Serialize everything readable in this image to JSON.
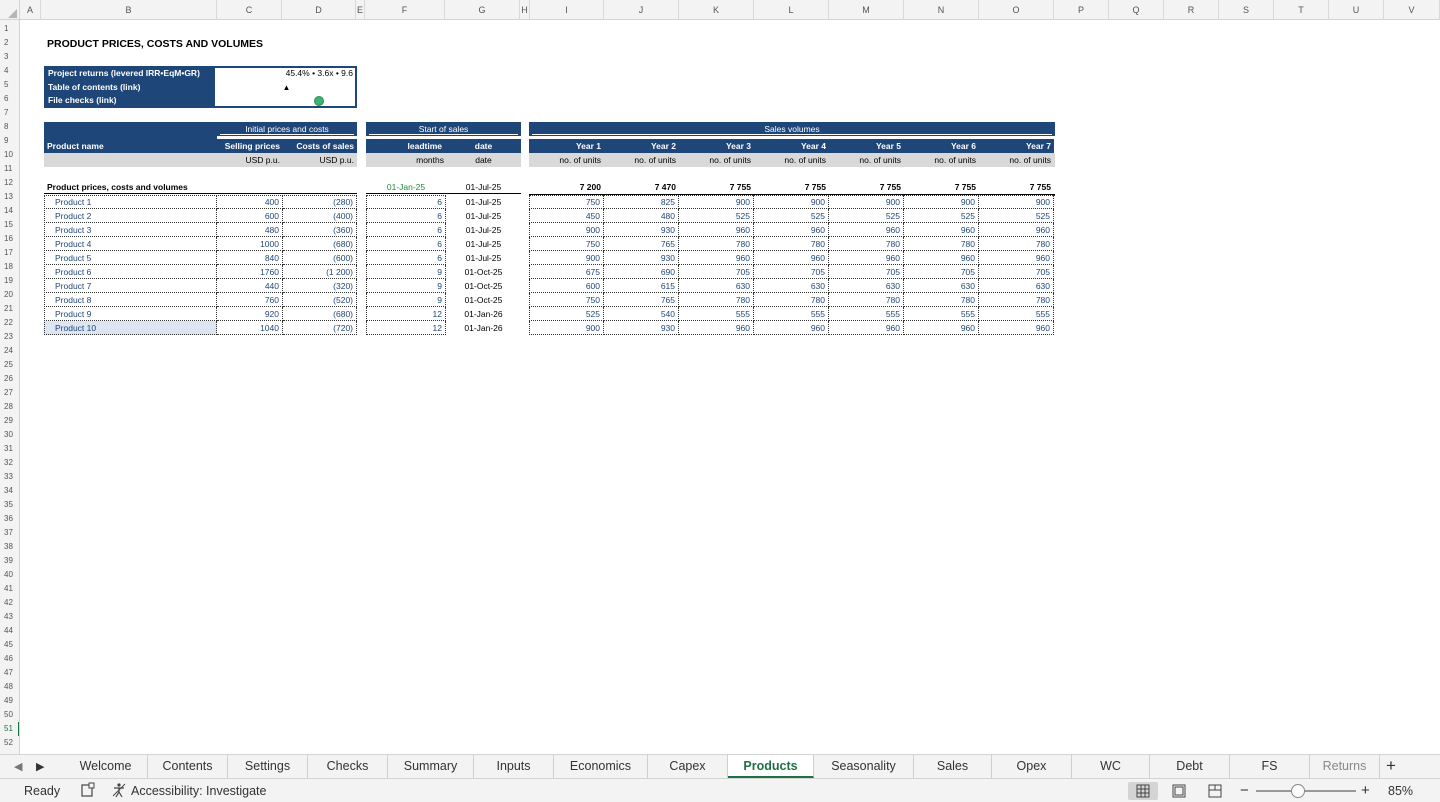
{
  "columns": [
    "A",
    "B",
    "C",
    "D",
    "E",
    "F",
    "G",
    "H",
    "I",
    "J",
    "K",
    "L",
    "M",
    "N",
    "O",
    "P",
    "Q",
    "R",
    "S",
    "T",
    "U",
    "V"
  ],
  "rows": [
    "1",
    "2",
    "3",
    "4",
    "5",
    "6",
    "7",
    "8",
    "9",
    "10",
    "11",
    "12",
    "13",
    "14",
    "15",
    "16",
    "17",
    "18",
    "19",
    "20",
    "21",
    "22",
    "23",
    "24",
    "25",
    "26",
    "27",
    "28",
    "29",
    "30",
    "31",
    "32",
    "33",
    "34",
    "35",
    "36",
    "37",
    "38",
    "39",
    "40",
    "41",
    "42",
    "43",
    "44",
    "45",
    "46",
    "47",
    "48",
    "49",
    "50",
    "51",
    "52"
  ],
  "active_row": "51",
  "sheet": {
    "title": "PRODUCT PRICES, COSTS AND VOLUMES",
    "summary_box": {
      "project_returns_label": "Project returns (levered IRR•EqM•GR)",
      "project_returns_value": "45.4% • 3.6x • 9.6",
      "toc_label": "Table of contents (link)",
      "toc_value": "▲",
      "checks_label": "File checks (link)",
      "checks_status": "ok",
      "checks_color": "#3cb371"
    },
    "header": {
      "initial_group": "Initial prices and costs",
      "start_group": "Start of sales",
      "volumes_group": "Sales volumes",
      "product_name": "Product name",
      "selling_prices": "Selling prices",
      "costs_of_sales": "Costs of sales",
      "leadtime": "leadtime",
      "date": "date",
      "years": [
        "Year 1",
        "Year 2",
        "Year 3",
        "Year 4",
        "Year 5",
        "Year 6",
        "Year 7"
      ],
      "unit_price": "USD p.u.",
      "unit_cost": "USD p.u.",
      "unit_leadtime": "months",
      "unit_date": "date",
      "unit_volume": "no. of units"
    },
    "totals": {
      "label": "Product prices, costs and volumes",
      "start_date": "01-Jan-25",
      "first_sale": "01-Jul-25",
      "volumes": [
        "7 200",
        "7 470",
        "7 755",
        "7 755",
        "7 755",
        "7 755",
        "7 755"
      ]
    },
    "products": [
      {
        "name": "Product 1",
        "price": "400",
        "cost": "(280)",
        "leadtime": "6",
        "date": "01-Jul-25",
        "vol": [
          "750",
          "825",
          "900",
          "900",
          "900",
          "900",
          "900"
        ]
      },
      {
        "name": "Product 2",
        "price": "600",
        "cost": "(400)",
        "leadtime": "6",
        "date": "01-Jul-25",
        "vol": [
          "450",
          "480",
          "525",
          "525",
          "525",
          "525",
          "525"
        ]
      },
      {
        "name": "Product 3",
        "price": "480",
        "cost": "(360)",
        "leadtime": "6",
        "date": "01-Jul-25",
        "vol": [
          "900",
          "930",
          "960",
          "960",
          "960",
          "960",
          "960"
        ]
      },
      {
        "name": "Product 4",
        "price": "1000",
        "cost": "(680)",
        "leadtime": "6",
        "date": "01-Jul-25",
        "vol": [
          "750",
          "765",
          "780",
          "780",
          "780",
          "780",
          "780"
        ]
      },
      {
        "name": "Product 5",
        "price": "840",
        "cost": "(600)",
        "leadtime": "6",
        "date": "01-Jul-25",
        "vol": [
          "900",
          "930",
          "960",
          "960",
          "960",
          "960",
          "960"
        ]
      },
      {
        "name": "Product 6",
        "price": "1760",
        "cost": "(1 200)",
        "leadtime": "9",
        "date": "01-Oct-25",
        "vol": [
          "675",
          "690",
          "705",
          "705",
          "705",
          "705",
          "705"
        ]
      },
      {
        "name": "Product 7",
        "price": "440",
        "cost": "(320)",
        "leadtime": "9",
        "date": "01-Oct-25",
        "vol": [
          "600",
          "615",
          "630",
          "630",
          "630",
          "630",
          "630"
        ]
      },
      {
        "name": "Product 8",
        "price": "760",
        "cost": "(520)",
        "leadtime": "9",
        "date": "01-Oct-25",
        "vol": [
          "750",
          "765",
          "780",
          "780",
          "780",
          "780",
          "780"
        ]
      },
      {
        "name": "Product 9",
        "price": "920",
        "cost": "(680)",
        "leadtime": "12",
        "date": "01-Jan-26",
        "vol": [
          "525",
          "540",
          "555",
          "555",
          "555",
          "555",
          "555"
        ]
      },
      {
        "name": "Product 10",
        "price": "1040",
        "cost": "(720)",
        "leadtime": "12",
        "date": "01-Jan-26",
        "vol": [
          "900",
          "930",
          "960",
          "960",
          "960",
          "960",
          "960"
        ]
      }
    ]
  },
  "tabs": [
    "Welcome",
    "Contents",
    "Settings",
    "Checks",
    "Summary",
    "Inputs",
    "Economics",
    "Capex",
    "Products",
    "Seasonality",
    "Sales",
    "Opex",
    "WC",
    "Debt",
    "FS",
    "Returns"
  ],
  "active_tab": "Products",
  "status": {
    "ready": "Ready",
    "accessibility": "Accessibility: Investigate",
    "zoom": "85%",
    "zoom_level": 0.85
  }
}
